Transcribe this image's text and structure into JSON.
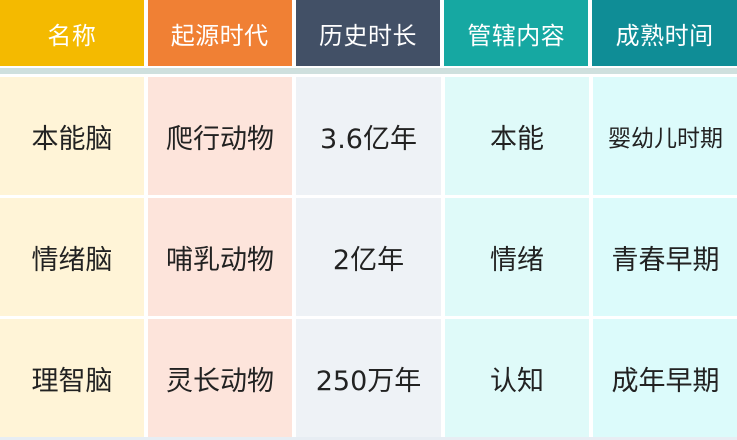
{
  "colors": {
    "header": [
      "#f4ba00",
      "#f08034",
      "#425066",
      "#16a8a2",
      "#0f8d96"
    ],
    "column_fill": [
      "#fff4d7",
      "#fde4db",
      "#eef2f6",
      "#dffaf9",
      "#dcfbfb"
    ],
    "divider": "#cfe0de"
  },
  "headers": [
    "名称",
    "起源时代",
    "历史时长",
    "管辖内容",
    "成熟时间"
  ],
  "rows": [
    [
      "本能脑",
      "爬行动物",
      "3.6亿年",
      "本能",
      "婴幼儿时期"
    ],
    [
      "情绪脑",
      "哺乳动物",
      "2亿年",
      "情绪",
      "青春早期"
    ],
    [
      "理智脑",
      "灵长动物",
      "250万年",
      "认知",
      "成年早期"
    ]
  ]
}
